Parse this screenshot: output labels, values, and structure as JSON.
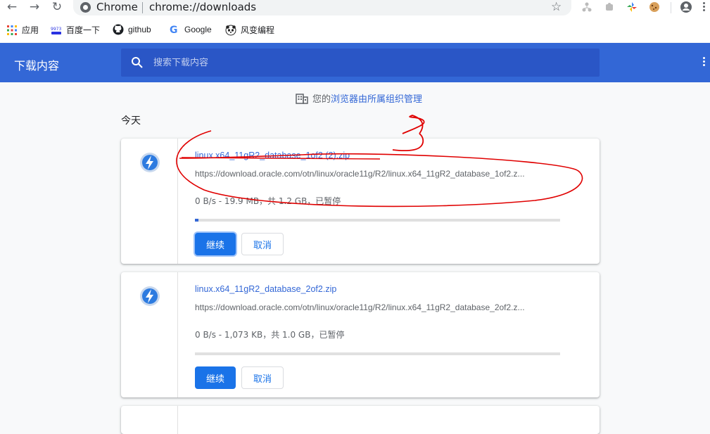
{
  "browser": {
    "omnibox_site": "Chrome",
    "omnibox_url": "chrome://downloads"
  },
  "bookmarks": [
    {
      "label": "应用"
    },
    {
      "label": "百度一下"
    },
    {
      "label": "github"
    },
    {
      "label": "Google"
    },
    {
      "label": "风变编程"
    }
  ],
  "header": {
    "title": "下载内容",
    "search_placeholder": "搜索下载内容"
  },
  "managed": {
    "prefix": "您的",
    "link": "浏览器由所属组织管理"
  },
  "section_date": "今天",
  "downloads": [
    {
      "file_name": "linux.x64_11gR2_database_1of2 (2).zip",
      "url": "https://download.oracle.com/otn/linux/oracle11g/R2/linux.x64_11gR2_database_1of2.z...",
      "status": "0 B/s - 19.9 MB，共 1.2 GB，已暂停",
      "progress_percent": 1,
      "resume_label": "继续",
      "cancel_label": "取消"
    },
    {
      "file_name": "linux.x64_11gR2_database_2of2.zip",
      "url": "https://download.oracle.com/otn/linux/oracle11g/R2/linux.x64_11gR2_database_2of2.z...",
      "status": "0 B/s - 1,073 KB，共 1.0 GB，已暂停",
      "progress_percent": 0,
      "resume_label": "继续",
      "cancel_label": "取消"
    }
  ],
  "colors": {
    "header_bg": "#3367d6",
    "button_blue": "#1a73e8",
    "annotation_red": "#e00000"
  }
}
